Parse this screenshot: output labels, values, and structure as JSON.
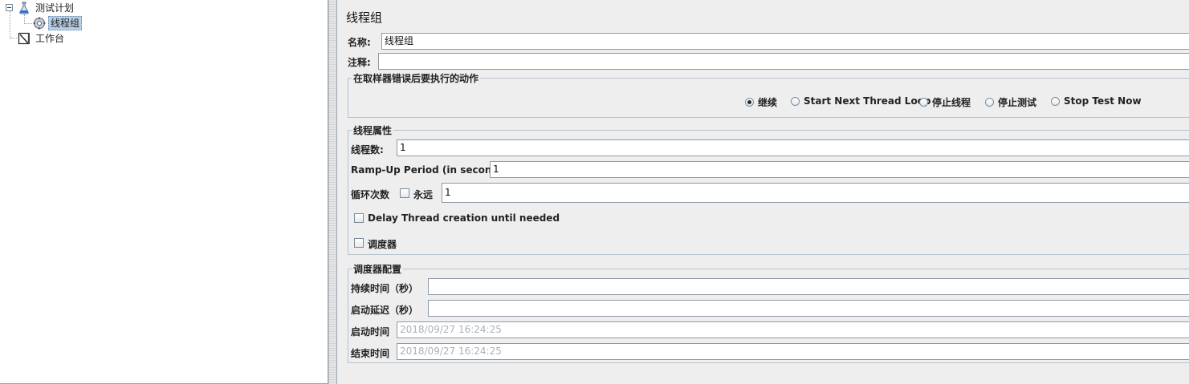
{
  "tree": {
    "items": [
      {
        "label": "测试计划",
        "icon": "test-plan-flask-icon"
      },
      {
        "label": "线程组",
        "icon": "thread-group-gear-icon",
        "selected": true
      },
      {
        "label": "工作台",
        "icon": "workbench-icon"
      }
    ]
  },
  "panel": {
    "title": "线程组",
    "name_label": "名称:",
    "name_value": "线程组",
    "comment_label": "注释:",
    "comment_value": ""
  },
  "sampler_error": {
    "title": "在取样器错误后要执行的动作",
    "options": [
      {
        "label": "继续",
        "selected": true
      },
      {
        "label": "Start Next Thread Loop",
        "selected": false
      },
      {
        "label": "停止线程",
        "selected": false
      },
      {
        "label": "停止测试",
        "selected": false
      },
      {
        "label": "Stop Test Now",
        "selected": false
      }
    ]
  },
  "thread_props": {
    "title": "线程属性",
    "threads_label": "线程数:",
    "threads_value": "1",
    "rampup_label": "Ramp-Up Period (in seconds):",
    "rampup_value": "1",
    "loop_label": "循环次数",
    "forever_label": "永远",
    "forever_checked": false,
    "loop_value": "1",
    "delay_label": "Delay Thread creation until needed",
    "delay_checked": false,
    "scheduler_label": "调度器",
    "scheduler_checked": false
  },
  "scheduler_config": {
    "title": "调度器配置",
    "duration_label": "持续时间（秒）",
    "duration_value": "",
    "delay_label": "启动延迟（秒）",
    "delay_value": "",
    "start_label": "启动时间",
    "start_value": "2018/09/27 16:24:25",
    "end_label": "结束时间",
    "end_value": "2018/09/27 16:24:25"
  },
  "colors": {
    "panel_bg": "#eeeeee",
    "tree_bg": "#ffffff",
    "selection_bg": "#b8cfe5",
    "disabled_text": "#a9b2bd"
  }
}
